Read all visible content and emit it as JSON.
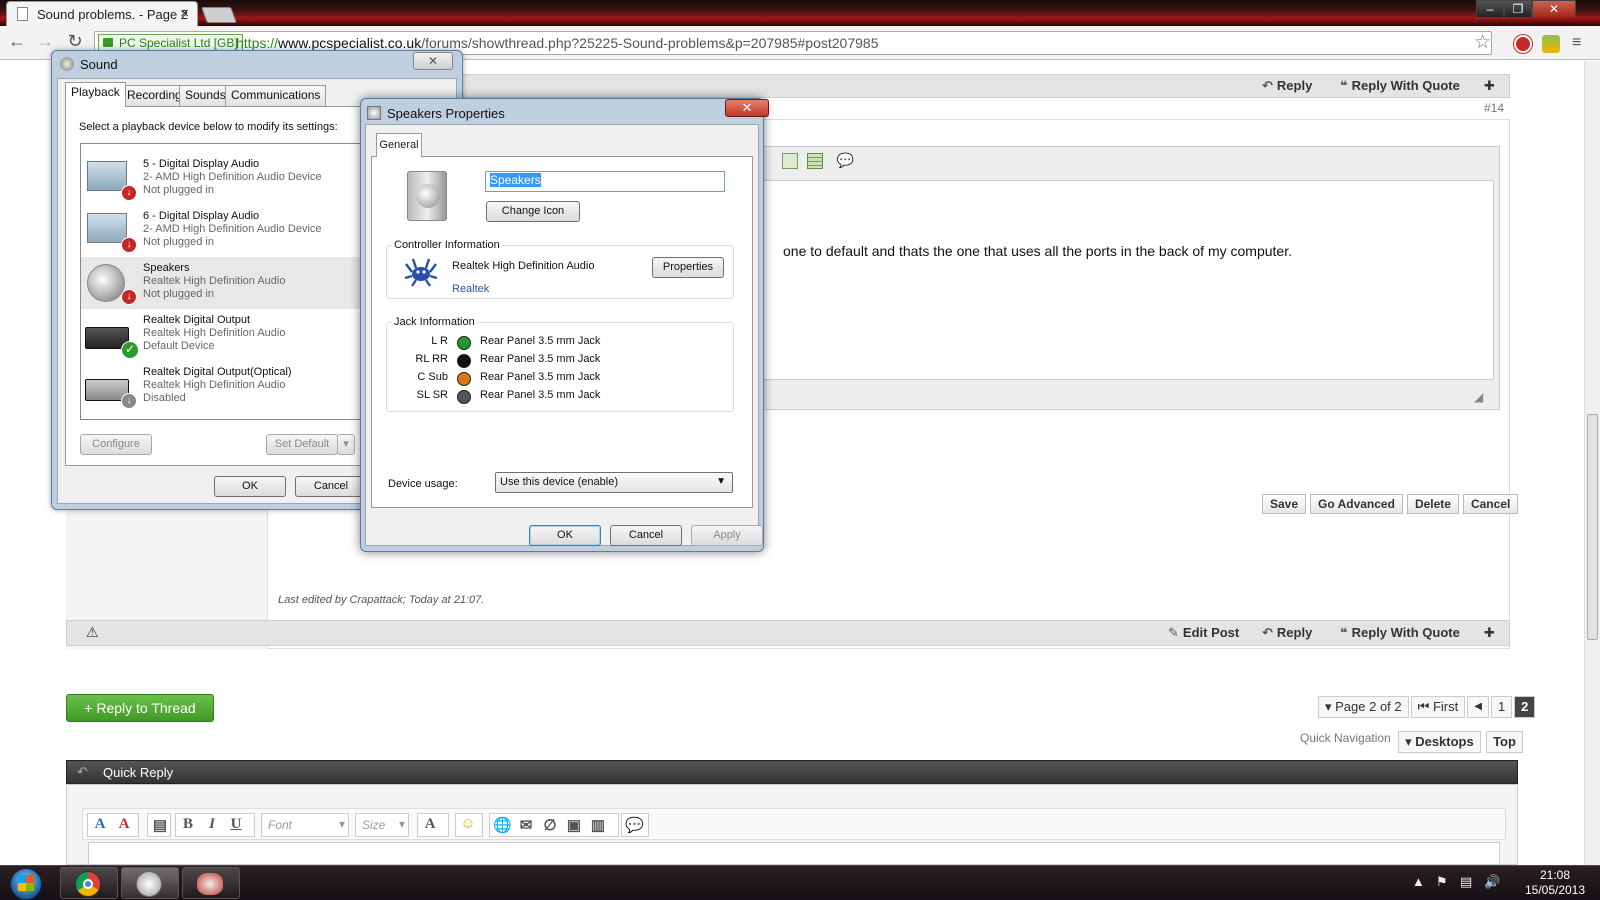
{
  "browser": {
    "tab_title": "Sound problems. - Page 2",
    "tab_close": "×",
    "ev_label": "PC Specialist Ltd [GB]",
    "url_scheme": "https://",
    "url_host": "www.pcspecialist.co.uk",
    "url_path": "/forums/showthread.php?25225-Sound-problems&p=207985#post207985",
    "minimize": "‒",
    "restore": "❐",
    "close": "✕"
  },
  "post": {
    "reply": "Reply",
    "reply_quote": "Reply With Quote",
    "number": "#14",
    "text": "one to default and thats the one that uses all the ports in the back of my computer.",
    "last_edited_prefix": "Last edited by Crapattack;",
    "last_edited_when": "Today at 21:07.",
    "edit_post": "Edit Post",
    "buttons": {
      "save": "Save",
      "go_advanced": "Go Advanced",
      "delete": "Delete",
      "cancel": "Cancel"
    }
  },
  "thread": {
    "reply_to_thread": "+ Reply to Thread",
    "page_of": "Page 2 of 2",
    "first": "First",
    "prev": "◀",
    "pages": [
      "1",
      "2"
    ],
    "quick_nav_label": "Quick Navigation",
    "quick_nav_value": "Desktops",
    "top": "Top"
  },
  "quick_reply": {
    "title": "Quick Reply",
    "font_placeholder": "Font",
    "size_placeholder": "Size"
  },
  "sound": {
    "title": "Sound",
    "tabs": [
      "Playback",
      "Recording",
      "Sounds",
      "Communications"
    ],
    "hint": "Select a playback device below to modify its settings:",
    "devices": [
      {
        "name": "5 - Digital Display Audio",
        "sub": "2- AMD High Definition Audio Device",
        "status": "Not plugged in"
      },
      {
        "name": "6 - Digital Display Audio",
        "sub": "2- AMD High Definition Audio Device",
        "status": "Not plugged in"
      },
      {
        "name": "Speakers",
        "sub": "Realtek High Definition Audio",
        "status": "Not plugged in"
      },
      {
        "name": "Realtek Digital Output",
        "sub": "Realtek High Definition Audio",
        "status": "Default Device"
      },
      {
        "name": "Realtek Digital Output(Optical)",
        "sub": "Realtek High Definition Audio",
        "status": "Disabled"
      }
    ],
    "configure": "Configure",
    "set_default": "Set Default",
    "ok": "OK",
    "cancel": "Cancel"
  },
  "props": {
    "title": "Speakers Properties",
    "close": "✕",
    "tab": "General",
    "device_name": "Speakers",
    "change_icon": "Change Icon",
    "controller_label": "Controller Information",
    "controller_name": "Realtek High Definition Audio",
    "controller_vendor": "Realtek",
    "properties_btn": "Properties",
    "jack_label": "Jack Information",
    "jacks": [
      {
        "channel": "L R",
        "desc": "Rear Panel 3.5 mm Jack",
        "color": "#1e9a2a"
      },
      {
        "channel": "RL RR",
        "desc": "Rear Panel 3.5 mm Jack",
        "color": "#111111"
      },
      {
        "channel": "C Sub",
        "desc": "Rear Panel 3.5 mm Jack",
        "color": "#d97a12"
      },
      {
        "channel": "SL SR",
        "desc": "Rear Panel 3.5 mm Jack",
        "color": "#555555"
      }
    ],
    "device_usage_label": "Device usage:",
    "device_usage_value": "Use this device (enable)",
    "ok": "OK",
    "cancel": "Cancel",
    "apply": "Apply"
  },
  "taskbar": {
    "time": "21:08",
    "date": "15/05/2013"
  }
}
